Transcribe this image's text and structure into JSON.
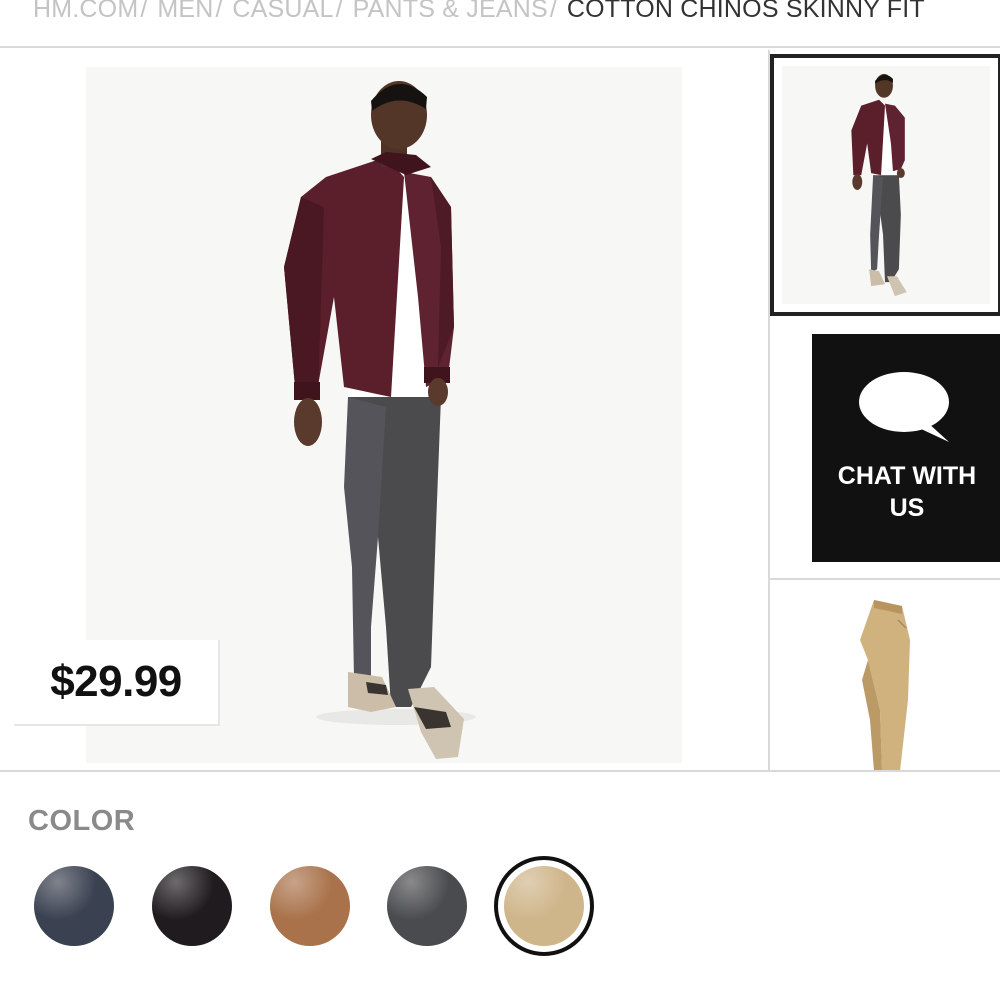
{
  "breadcrumb": {
    "items": [
      {
        "label": "HM.COM"
      },
      {
        "label": "MEN"
      },
      {
        "label": "CASUAL"
      },
      {
        "label": "PANTS & JEANS"
      }
    ],
    "separator": "/",
    "current": "COTTON CHINOS SKINNY FIT"
  },
  "product": {
    "price": "$29.99"
  },
  "chat": {
    "label_line1": "CHAT WITH",
    "label_line2": "US",
    "icon": "speech-bubble-icon"
  },
  "colors": {
    "title": "COLOR",
    "swatches": [
      {
        "name": "dark-blue",
        "hex": "#3a4150"
      },
      {
        "name": "black",
        "hex": "#1f1b1f"
      },
      {
        "name": "brown",
        "hex": "#a9724a"
      },
      {
        "name": "dark-gray",
        "hex": "#4a4b4e"
      },
      {
        "name": "beige",
        "hex": "#cfb58a",
        "selected": true
      }
    ]
  },
  "theme": {
    "accent": "#111111",
    "muted_text": "#c4c4c4",
    "divider": "#d9d9d9"
  }
}
